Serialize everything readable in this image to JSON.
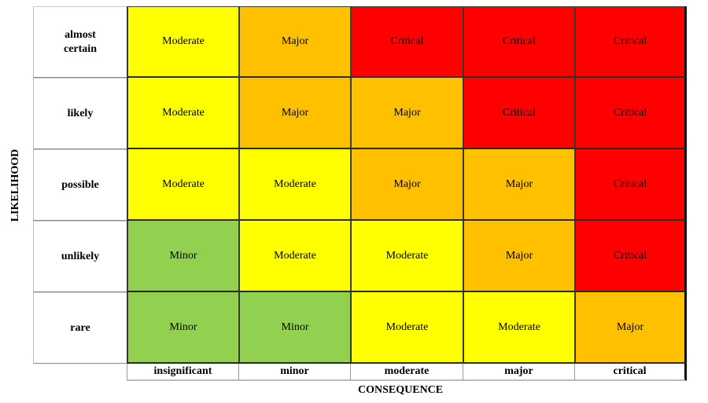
{
  "axes": {
    "y_label": "LIKELIHOOD",
    "x_label": "CONSEQUENCE"
  },
  "likelihood_levels": [
    "almost certain",
    "likely",
    "possible",
    "unlikely",
    "rare"
  ],
  "consequence_levels": [
    "insignificant",
    "minor",
    "moderate",
    "major",
    "critical"
  ],
  "rating_colors": {
    "Minor": "#92d050",
    "Moderate": "#ffff00",
    "Major": "#ffc000",
    "Critical": "#ff0000"
  },
  "matrix": [
    [
      "Moderate",
      "Major",
      "Critical",
      "Critical",
      "Critical"
    ],
    [
      "Moderate",
      "Major",
      "Major",
      "Critical",
      "Critical"
    ],
    [
      "Moderate",
      "Moderate",
      "Major",
      "Major",
      "Critical"
    ],
    [
      "Minor",
      "Moderate",
      "Moderate",
      "Major",
      "Critical"
    ],
    [
      "Minor",
      "Minor",
      "Moderate",
      "Moderate",
      "Major"
    ]
  ]
}
